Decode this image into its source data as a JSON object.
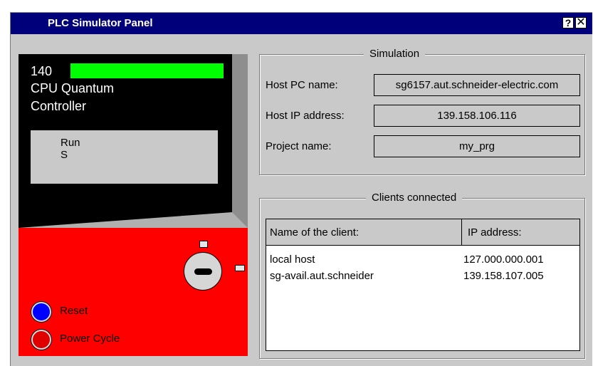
{
  "window": {
    "title": "PLC Simulator Panel",
    "help_label": "?",
    "close_label": "✕"
  },
  "plc": {
    "model": "140",
    "cpu": "CPU Quantum",
    "type": "Controller",
    "status_line1": "Run",
    "status_line2": "S",
    "reset_label": "Reset",
    "power_cycle_label": "Power Cycle",
    "colors": {
      "run_led": "#00ff00",
      "body_top": "#000000",
      "body_bottom": "#ff0000",
      "reset": "#0000ff",
      "power": "#e00000"
    }
  },
  "simulation": {
    "title": "Simulation",
    "fields": [
      {
        "label": "Host PC name:",
        "value": "sg6157.aut.schneider-electric.com"
      },
      {
        "label": "Host IP address:",
        "value": "139.158.106.116"
      },
      {
        "label": "Project name:",
        "value": "my_prg"
      }
    ]
  },
  "clients": {
    "title": "Clients connected",
    "columns": [
      "Name of the client:",
      "IP address:"
    ],
    "rows": [
      {
        "name": "local host",
        "ip": "127.000.000.001"
      },
      {
        "name": "sg-avail.aut.schneider",
        "ip": "139.158.107.005"
      }
    ]
  }
}
